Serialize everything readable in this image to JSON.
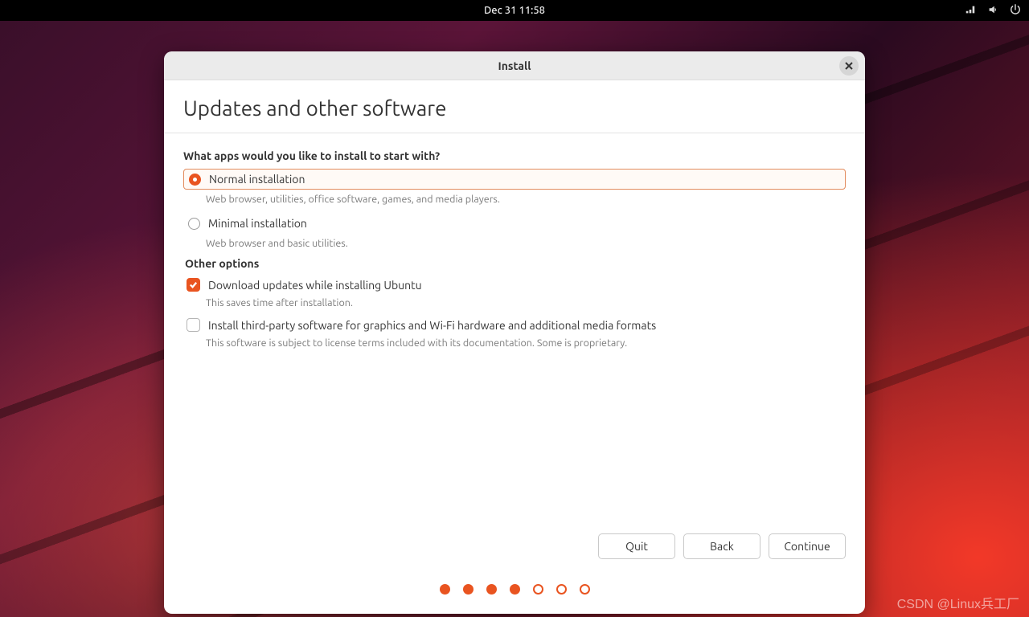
{
  "topbar": {
    "clock": "Dec 31  11:58"
  },
  "window": {
    "title": "Install",
    "heading": "Updates and other software",
    "question": "What apps would you like to install to start with?",
    "options": {
      "normal": {
        "label": "Normal installation",
        "desc": "Web browser, utilities, office software, games, and media players."
      },
      "minimal": {
        "label": "Minimal installation",
        "desc": "Web browser and basic utilities."
      }
    },
    "other_label": "Other options",
    "checks": {
      "download": {
        "label": "Download updates while installing Ubuntu",
        "desc": "This saves time after installation."
      },
      "thirdparty": {
        "label": "Install third-party software for graphics and Wi-Fi hardware and additional media formats",
        "desc": "This software is subject to license terms included with its documentation. Some is proprietary."
      }
    },
    "buttons": {
      "quit": "Quit",
      "back": "Back",
      "continue": "Continue"
    }
  },
  "watermark": "CSDN @Linux兵工厂"
}
